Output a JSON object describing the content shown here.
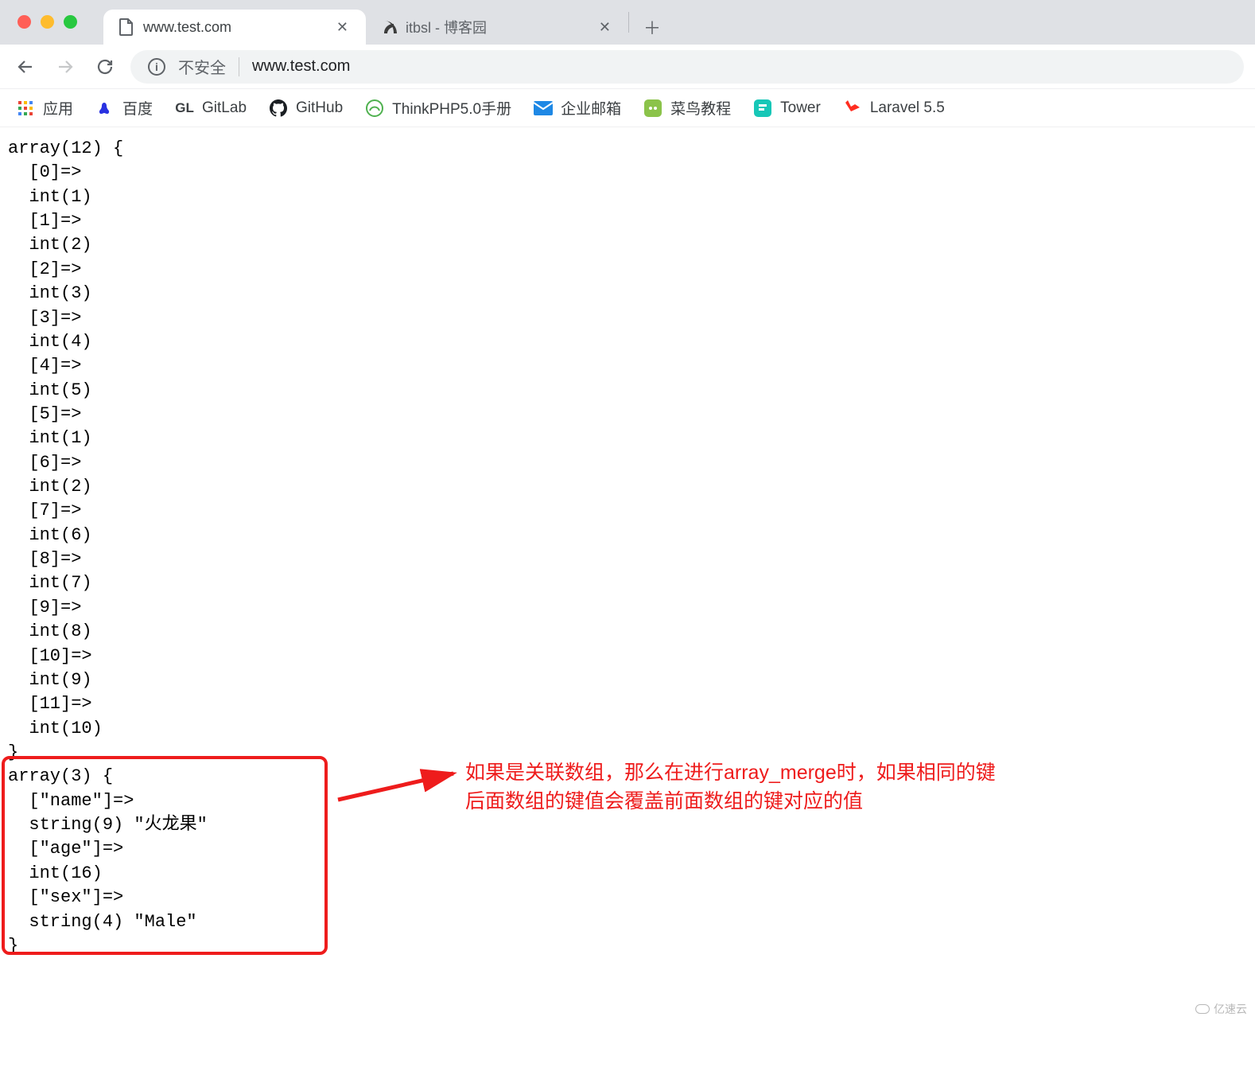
{
  "window": {
    "traffic_colors": {
      "close": "#ff5f57",
      "min": "#febc2e",
      "max": "#28c840"
    }
  },
  "tabs": [
    {
      "title": "www.test.com",
      "favicon": "page-icon",
      "active": true
    },
    {
      "title": "itbsl - 博客园",
      "favicon": "cnblogs-icon",
      "active": false
    }
  ],
  "toolbar": {
    "security_label": "不安全",
    "url": "www.test.com"
  },
  "bookmarks": [
    {
      "label": "应用",
      "icon": "apps-grid-icon"
    },
    {
      "label": "百度",
      "icon": "baidu-icon"
    },
    {
      "label": "GitLab",
      "icon": "gitlab-text-icon",
      "icon_text": "GL"
    },
    {
      "label": "GitHub",
      "icon": "github-icon"
    },
    {
      "label": "ThinkPHP5.0手册",
      "icon": "thinkphp-icon"
    },
    {
      "label": "企业邮箱",
      "icon": "mail-icon"
    },
    {
      "label": "菜鸟教程",
      "icon": "runoob-icon"
    },
    {
      "label": "Tower",
      "icon": "tower-icon"
    },
    {
      "label": "Laravel 5.5",
      "icon": "laravel-icon"
    }
  ],
  "dump": {
    "array1": {
      "count": 12,
      "entries": [
        {
          "key": "0",
          "type": "int",
          "value": "1"
        },
        {
          "key": "1",
          "type": "int",
          "value": "2"
        },
        {
          "key": "2",
          "type": "int",
          "value": "3"
        },
        {
          "key": "3",
          "type": "int",
          "value": "4"
        },
        {
          "key": "4",
          "type": "int",
          "value": "5"
        },
        {
          "key": "5",
          "type": "int",
          "value": "1"
        },
        {
          "key": "6",
          "type": "int",
          "value": "2"
        },
        {
          "key": "7",
          "type": "int",
          "value": "6"
        },
        {
          "key": "8",
          "type": "int",
          "value": "7"
        },
        {
          "key": "9",
          "type": "int",
          "value": "8"
        },
        {
          "key": "10",
          "type": "int",
          "value": "9"
        },
        {
          "key": "11",
          "type": "int",
          "value": "10"
        }
      ]
    },
    "array2": {
      "count": 3,
      "entries": [
        {
          "key": "\"name\"",
          "type": "string",
          "len": "9",
          "value": "\"火龙果\""
        },
        {
          "key": "\"age\"",
          "type": "int",
          "value": "16"
        },
        {
          "key": "\"sex\"",
          "type": "string",
          "len": "4",
          "value": "\"Male\""
        }
      ]
    }
  },
  "annotation": {
    "line1": "如果是关联数组，那么在进行array_merge时，如果相同的键",
    "line2": "后面数组的键值会覆盖前面数组的键对应的值"
  },
  "watermark": "亿速云"
}
